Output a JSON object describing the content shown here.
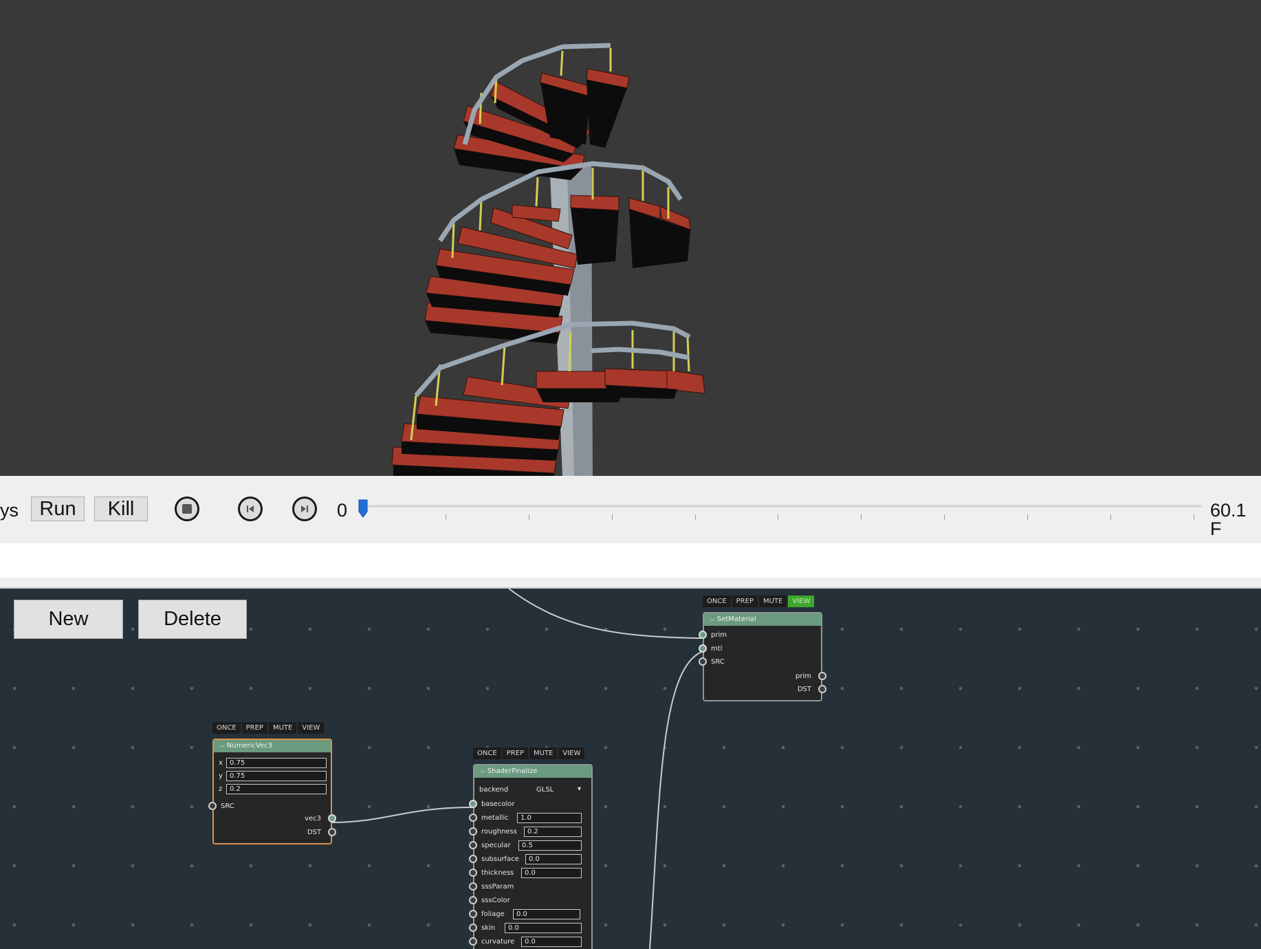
{
  "toolbar": {
    "mode_label_partial": "ys",
    "run_label": "Run",
    "kill_label": "Kill",
    "frame_value": "0",
    "fps_partial": "60.1 F"
  },
  "editor": {
    "new_label": "New",
    "delete_label": "Delete"
  },
  "node_flags": [
    "ONCE",
    "PREP",
    "MUTE",
    "VIEW"
  ],
  "nodes": {
    "set_material": {
      "title": "SetMaterial",
      "view_active": true,
      "inputs": [
        "prim",
        "mtl",
        "SRC"
      ],
      "outputs": [
        "prim",
        "DST"
      ]
    },
    "numeric_vec3": {
      "title": "NumericVec3",
      "params": [
        {
          "name": "x",
          "value": "0.75"
        },
        {
          "name": "y",
          "value": "0.75"
        },
        {
          "name": "z",
          "value": "0.2"
        }
      ],
      "inputs": [
        "SRC"
      ],
      "outputs": [
        "vec3",
        "DST"
      ]
    },
    "shader_finalize": {
      "title": "ShaderFinalize",
      "backend_label": "backend",
      "backend_value": "GLSL",
      "params": [
        {
          "name": "basecolor",
          "value": null
        },
        {
          "name": "metallic",
          "value": "1.0"
        },
        {
          "name": "roughness",
          "value": "0.2"
        },
        {
          "name": "specular",
          "value": "0.5"
        },
        {
          "name": "subsurface",
          "value": "0.0"
        },
        {
          "name": "thickness",
          "value": "0.0"
        },
        {
          "name": "sssParam",
          "value": null
        },
        {
          "name": "sssColor",
          "value": null
        },
        {
          "name": "foliage",
          "value": "0.0"
        },
        {
          "name": "skin",
          "value": "0.0"
        },
        {
          "name": "curvature",
          "value": "0.0"
        }
      ]
    }
  },
  "colors": {
    "viewport_bg": "#393939",
    "editor_bg": "#263038",
    "node_header": "#6a9a80",
    "selected_border": "#d9944a",
    "view_flag_active": "#3ea52e",
    "stair_tread": "#a8392a",
    "slider_thumb": "#1f6fd6"
  }
}
